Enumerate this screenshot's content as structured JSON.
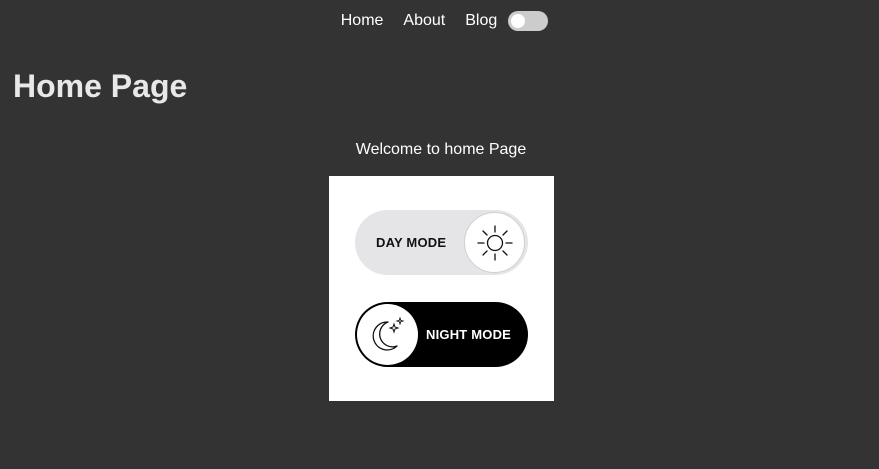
{
  "nav": {
    "links": [
      {
        "label": "Home"
      },
      {
        "label": "About"
      },
      {
        "label": "Blog"
      }
    ],
    "theme_toggle": {
      "state": "off"
    }
  },
  "page": {
    "title": "Home Page",
    "welcome": "Welcome to home Page"
  },
  "mode_image": {
    "day_label": "DAY MODE",
    "night_label": "NIGHT MODE",
    "day_icon": "sun-icon",
    "night_icon": "moon-stars-icon"
  },
  "colors": {
    "background": "#333333",
    "toggle_track": "#cccccc",
    "day_pill": "#e5e5e7",
    "night_pill": "#000000"
  }
}
